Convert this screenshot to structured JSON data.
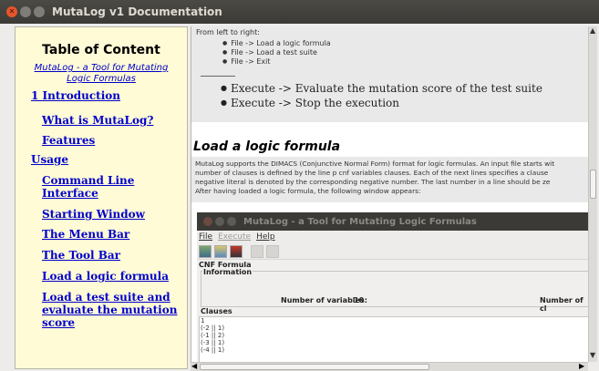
{
  "window": {
    "title": "MutaLog v1 Documentation"
  },
  "toc": {
    "title": "Table of Content",
    "subtitle": "MutaLog - a Tool for Mutating Logic Formulas",
    "items": [
      "1 Introduction",
      "What is MutaLog?",
      "Features",
      "Usage",
      "Command Line Interface",
      "Starting Window",
      "The Menu Bar",
      "The Tool Bar",
      "Load a logic formula",
      "Load a test suite and evaluate the mutation score"
    ]
  },
  "content": {
    "intro": "From left to right:",
    "file_bullets": [
      "File -> Load a logic formula",
      "File -> Load a test suite",
      "File -> Exit"
    ],
    "execute_bullets": [
      "Execute -> Evaluate the mutation score of the test suite",
      "Execute -> Stop the execution"
    ],
    "heading": "Load a logic formula",
    "paragraph_lines": [
      "MutaLog supports the DIMACS (Conjunctive Normal Form) format for logic formulas. An input file starts wit",
      "number of clauses is defined by the line p cnf variables clauses. Each of the next lines specifies a clause",
      "negative literal is denoted by the corresponding negative number. The last number in a line should be ze",
      "After having loaded a logic formula, the following window appears:"
    ]
  },
  "embedded": {
    "title": "MutaLog - a Tool for Mutating Logic Formulas",
    "menu": [
      "File",
      "Execute",
      "Help"
    ],
    "cnf_label": "CNF Formula",
    "information_label": "Information",
    "vars_label": "Number of variables:",
    "vars_value": "10",
    "clauses_count_label": "Number of cl",
    "clauses_label": "Clauses",
    "clause_lines": [
      "1",
      "(-2 || 1)",
      "(-1 || 2)",
      "(-3 || 1)",
      "(-4 || 1)"
    ]
  }
}
